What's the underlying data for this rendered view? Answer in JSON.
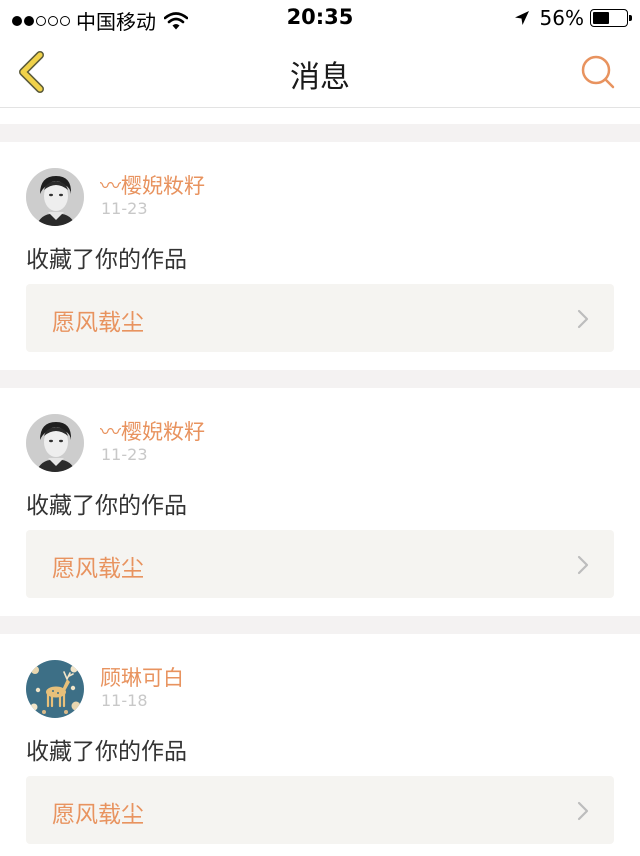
{
  "status_bar": {
    "carrier": "中国移动",
    "time": "20:35",
    "battery_percent_label": "56%",
    "battery_level": 0.56,
    "signal_bars_filled": 2,
    "signal_bars_total": 5
  },
  "nav": {
    "title": "消息",
    "back_icon": "chevron-left-icon",
    "search_icon": "search-icon",
    "accent_color": "#e8935f",
    "back_color": "#f0d24a"
  },
  "messages": [
    {
      "username": "〰樱婗籹籽",
      "date": "11-23",
      "action": "收藏了你的作品",
      "work_title": "愿风载尘",
      "avatar": "portrait-avatar"
    },
    {
      "username": "〰樱婗籹籽",
      "date": "11-23",
      "action": "收藏了你的作品",
      "work_title": "愿风载尘",
      "avatar": "portrait-avatar"
    },
    {
      "username": "顾琳可白",
      "date": "11-18",
      "action": "收藏了你的作品",
      "work_title": "愿风载尘",
      "avatar": "deer-pattern-avatar"
    }
  ],
  "colors": {
    "username": "#e8935f",
    "work_title": "#e8935f",
    "date": "#c8c8c8",
    "separator_band": "#f4f2f2",
    "work_box_bg": "#f5f4f1"
  }
}
